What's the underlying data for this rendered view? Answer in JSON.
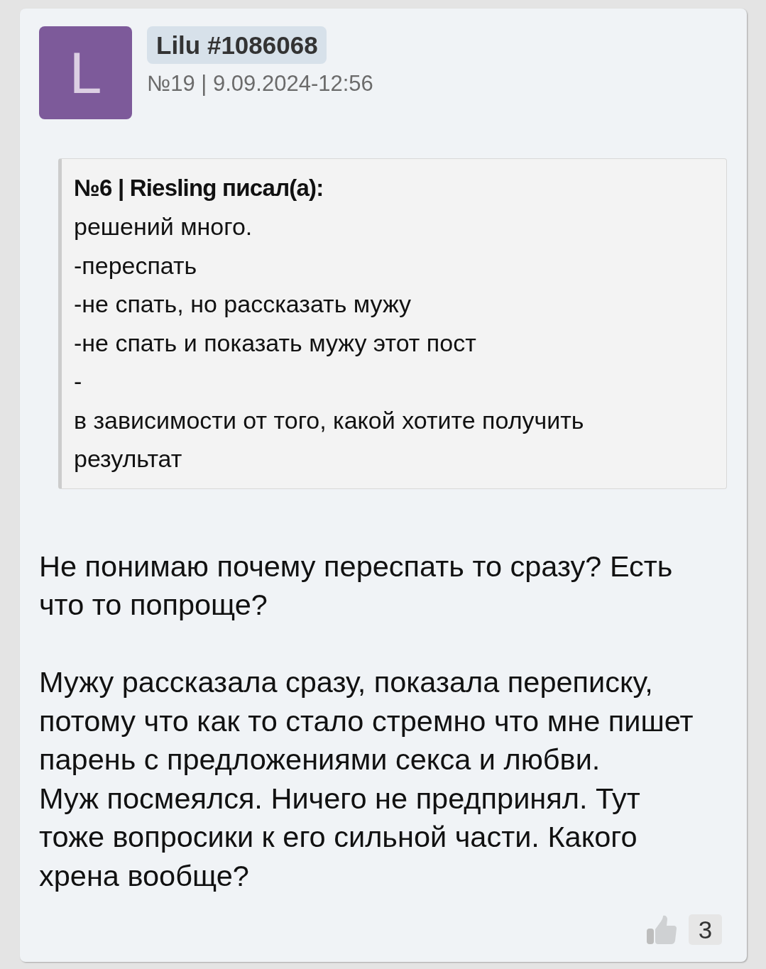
{
  "post": {
    "avatar": {
      "letter": "L"
    },
    "author": "Lilu #1086068",
    "meta": "№19 | 9.09.2024-12:56",
    "quote": {
      "header": "№6 | Riesling писал(а):",
      "lines": [
        "решений много.",
        "-переспать",
        "-не спать, но рассказать мужу",
        "-не спать и показать мужу этот пост",
        "-",
        "в зависимости от того, какой хотите получить результат"
      ]
    },
    "body": [
      {
        "lines": [
          "Не понимаю почему переспать то сразу? Есть что то попроще?"
        ]
      },
      {
        "lines": [
          "Мужу рассказала сразу, показала переписку, потому что как то стало стремно что мне пишет парень с предложениями секса и любви.",
          "Муж посмеялся. Ничего не предпринял. Тут тоже вопросики к его сильной части. Какого хрена вообще?"
        ]
      }
    ],
    "likes": {
      "count": "3"
    }
  }
}
